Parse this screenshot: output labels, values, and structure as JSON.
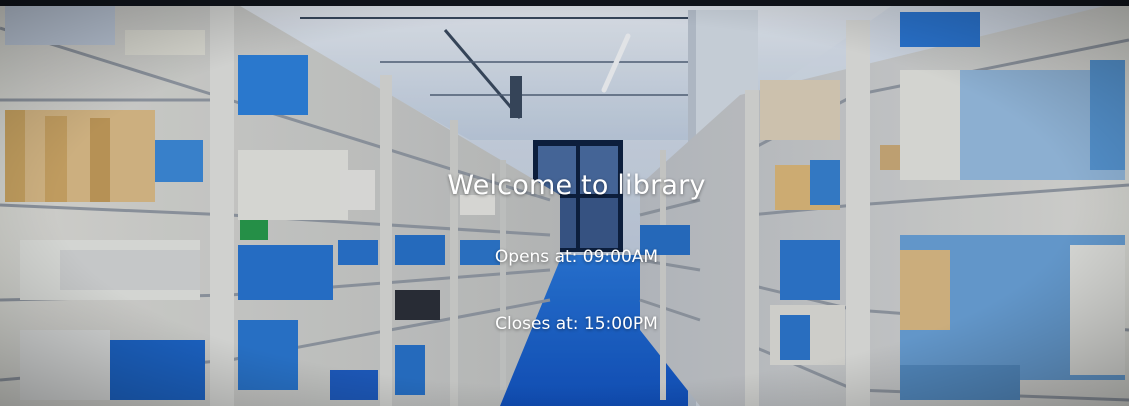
{
  "welcome": {
    "title": "Welcome to library",
    "opens": "Opens at: 09:00AM",
    "closes": "Closes at: 15:00PM"
  },
  "colors": {
    "floor": "#1e6fd9",
    "shelf": "#e8e6de",
    "ceiling": "#dfe6ee",
    "book_blue": "#2f7fd8",
    "book_tan": "#e6c083"
  },
  "icons": {
    "ceiling_light": "fluorescent-light",
    "window": "window-frame"
  }
}
